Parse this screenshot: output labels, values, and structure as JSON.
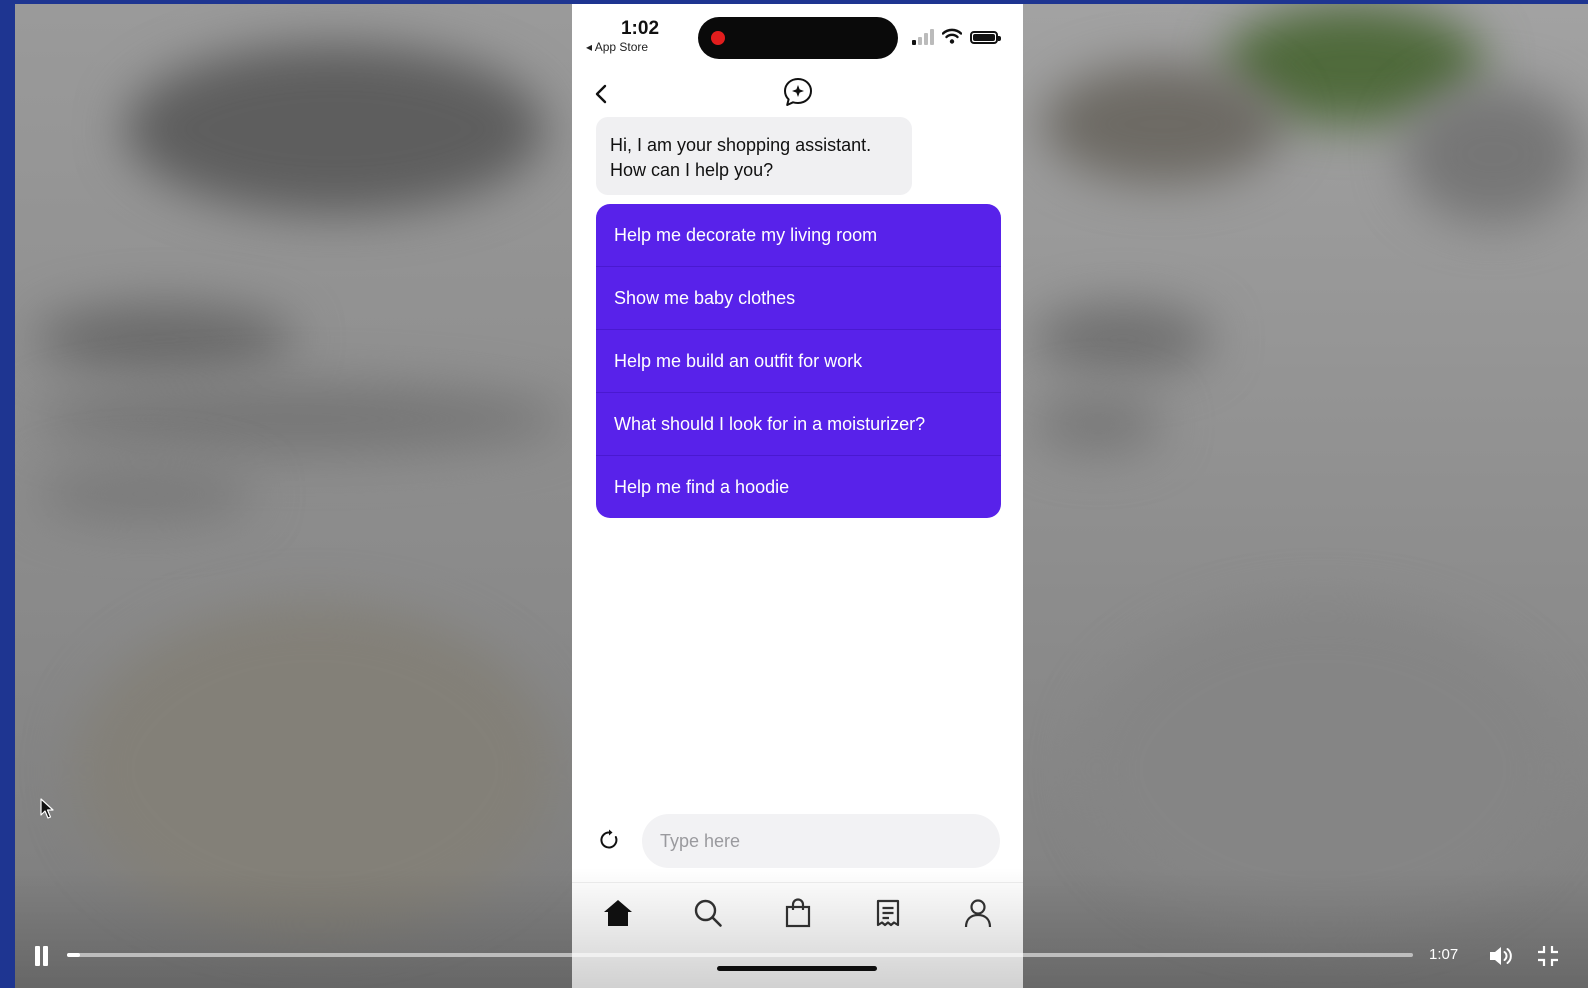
{
  "status_bar": {
    "time": "1:02",
    "back_to_app": "◂ App Store"
  },
  "chat": {
    "assistant_message": "Hi, I am your shopping assistant. How can I help you?",
    "suggestions": [
      "Help me decorate my living room",
      "Show me baby clothes",
      "Help me build an outfit for work",
      "What should I look for in a moisturizer?",
      "Help me find a hoodie"
    ],
    "input_placeholder": "Type here"
  },
  "tab_bar": {
    "tabs": [
      "home-icon",
      "search-icon",
      "shopping-bag-icon",
      "receipt-icon",
      "profile-icon"
    ],
    "active": "home-icon"
  },
  "video_player": {
    "elapsed_time": "1:07",
    "progress_fraction": 0.01
  },
  "colors": {
    "accent": "#5822ea",
    "frame": "#1e3591"
  }
}
